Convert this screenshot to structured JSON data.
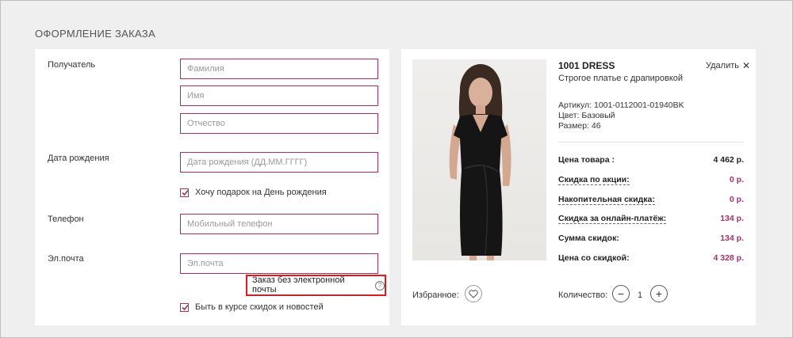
{
  "page": {
    "title": "ОФОРМЛЕНИЕ ЗАКАЗА"
  },
  "form": {
    "recipient_label": "Получатель",
    "last_name_placeholder": "Фамилия",
    "first_name_placeholder": "Имя",
    "patronymic_placeholder": "Отчество",
    "birthdate_label": "Дата рождения",
    "birthdate_placeholder": "Дата рождения (ДД.ММ.ГГГГ)",
    "birthday_gift_label": "Хочу подарок на День рождения",
    "birthday_gift_checked": true,
    "phone_label": "Телефон",
    "phone_placeholder": "Мобильный телефон",
    "email_label": "Эл.почта",
    "email_placeholder": "Эл.почта",
    "no_email_link": "Заказ без электронной почты",
    "help_symbol": "?",
    "newsletter_label": "Быть в курсе скидок и новостей",
    "newsletter_checked": true
  },
  "product": {
    "brand": "1001 DRESS",
    "description": "Строгое платье с драпировкой",
    "remove_label": "Удалить",
    "remove_symbol": "✕",
    "sku": "Артикул: 1001-0112001-01940BK",
    "color": "Цвет: Базовый",
    "size": "Размер: 46",
    "image_icon": "product-photo-dress"
  },
  "pricing": {
    "price_label": "Цена товара :",
    "price_value": "4 462 р.",
    "promo_label": "Скидка по акции:",
    "promo_value": "0 р.",
    "cumulative_label": "Накопительная скидка:",
    "cumulative_value": "0 р.",
    "online_label": "Скидка за онлайн-платёж:",
    "online_value": "134 р.",
    "total_discount_label": "Сумма скидок:",
    "total_discount_value": "134 р.",
    "final_label": "Цена со скидкой:",
    "final_value": "4 328 р."
  },
  "actions": {
    "favorites_label": "Избранное:",
    "quantity_label": "Количество:",
    "quantity_value": "1",
    "minus_symbol": "−",
    "plus_symbol": "+"
  },
  "colors": {
    "accent": "#a3306a",
    "highlight_border": "#e2191b",
    "background": "#efefef"
  }
}
